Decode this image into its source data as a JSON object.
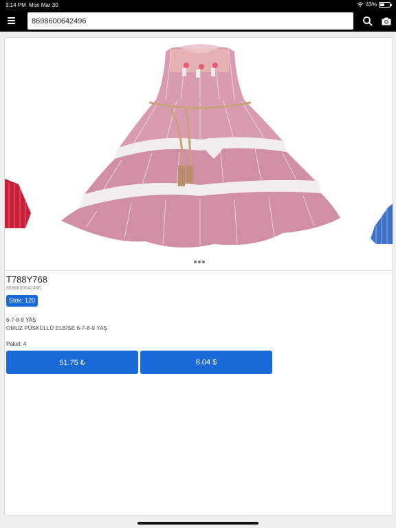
{
  "status": {
    "time": "3:14 PM",
    "date": "Mon Mar 30",
    "battery": "43%",
    "battery_level": 0.43
  },
  "toolbar": {
    "search_value": "8698600642496",
    "menu_icon": "hamburger-menu-icon",
    "search_icon": "magnifier-icon",
    "camera_icon": "camera-icon"
  },
  "product": {
    "code": "T788Y768",
    "barcode": "8698600642496",
    "stock_label": "Stok: 120",
    "age": "6-7-8-9 YAŞ",
    "description": "OMUZ PÜSKÜLLÜ ELBİSE 6-7-8-9 YAŞ",
    "paket": "Paket: 4",
    "price_try": "51.75 ₺",
    "price_usd": "8.04 $"
  },
  "colors": {
    "accent": "#1a69d8",
    "dress_pink": "#d99bb0",
    "left_dress": "#c8203a",
    "right_dress": "#3f72c8"
  }
}
